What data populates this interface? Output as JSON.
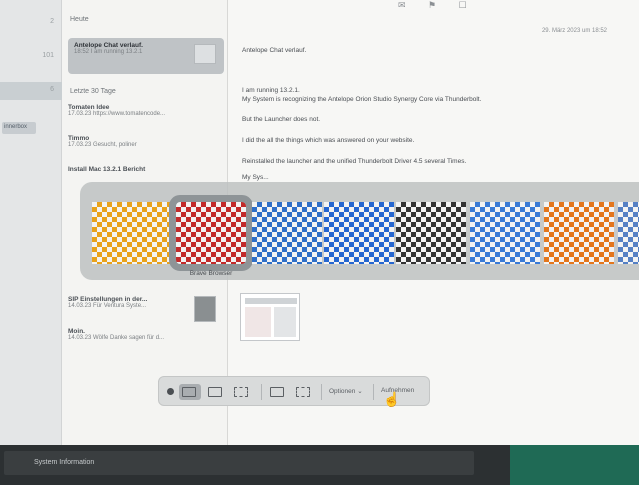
{
  "sidebar": {
    "rows": [
      {
        "count": "2"
      },
      {
        "count": "101"
      },
      {
        "count": "6"
      }
    ],
    "tag": "innerbox"
  },
  "list": {
    "header_today": "Heute",
    "header_last30": "Letzte 30 Tage",
    "selected": {
      "title": "Antelope Chat verlauf.",
      "preview": "18:52 I am running 13.2.1"
    },
    "items": [
      {
        "title": "Tomaten Idee",
        "preview": "17.03.23 https://www.tomatencode..."
      },
      {
        "title": "Timmo",
        "preview": "17.03.23 Gesucht, poliner"
      },
      {
        "title": "Install Mac 13.2.1 Bericht",
        "preview": ""
      },
      {
        "title": "SIP Einstellungen in der...",
        "preview": "14.03.23 Für Ventura Syste..."
      },
      {
        "title": "Moin.",
        "preview": "14.03.23 Wölfe Danke sagen für d..."
      }
    ]
  },
  "message": {
    "date": "29. März 2023 um 18:52",
    "subject": "Antelope Chat verlauf.",
    "lines": [
      "I am running 13.2.1.",
      "My System is recognizing the Antelope Orion Studio Synergy Core via Thunderbolt.",
      "But the Launcher does not.",
      "I did the all the things which was answered on your website.",
      "Reinstalled the launcher and the unified Thunderbolt Driver 4.5 several Times.",
      "My Sys..."
    ]
  },
  "shelf": {
    "selected_caption": "Brave Browser",
    "tile_colors": [
      "#e8a21b",
      "#c22a2a",
      "#2f6fc7",
      "#2566d0",
      "#333333",
      "#3a7bd6",
      "#e3761c",
      "#5580c4"
    ]
  },
  "screenshot_toolbar": {
    "options_label": "Optionen",
    "capture_label": "Aufnehmen"
  },
  "taskbar": {
    "system_info": "System Information"
  },
  "colors": {
    "accent": "#1f6a55",
    "shelf": "#bcc0c0"
  }
}
